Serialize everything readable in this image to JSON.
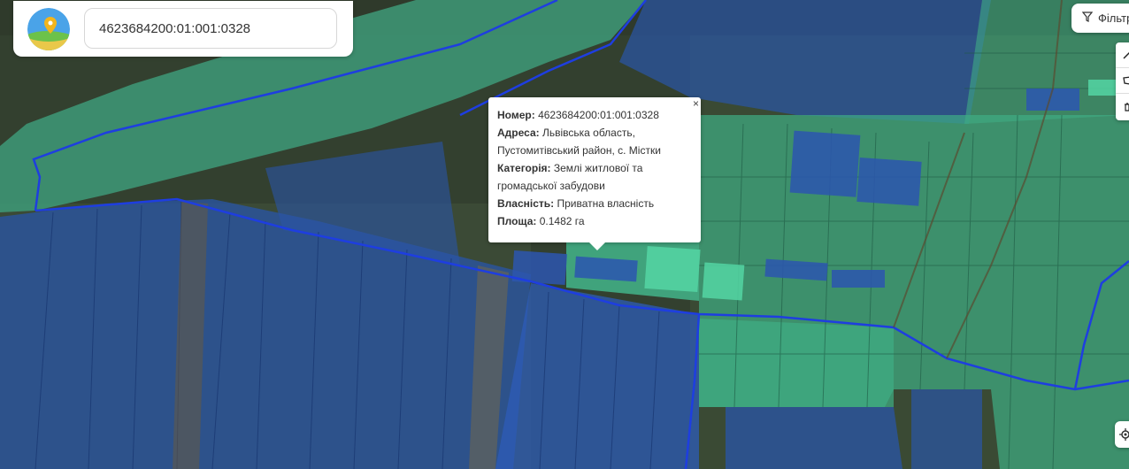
{
  "search": {
    "value": "4623684200:01:001:0328"
  },
  "filter": {
    "label": "Фільтр"
  },
  "popup": {
    "number_label": "Номер:",
    "number_value": "4623684200:01:001:0328",
    "address_label": "Адреса:",
    "address_value_1": "Львівська область,",
    "address_value_2": "Пустомитівський район, с. Містки",
    "category_label": "Категорія:",
    "category_value_1": "Землі житлової та",
    "category_value_2": "громадської забудови",
    "ownership_label": "Власність:",
    "ownership_value": "Приватна власність",
    "area_label": "Площа:",
    "area_value": "0.1482 га",
    "close": "×"
  },
  "colors": {
    "parcel_blue": "#2f5fb5",
    "parcel_green": "#3fbf8f",
    "boundary": "#1f3fd8"
  },
  "icons": {
    "logo": "map-pin-logo-icon",
    "filter": "filter-icon",
    "locate": "locate-icon"
  }
}
